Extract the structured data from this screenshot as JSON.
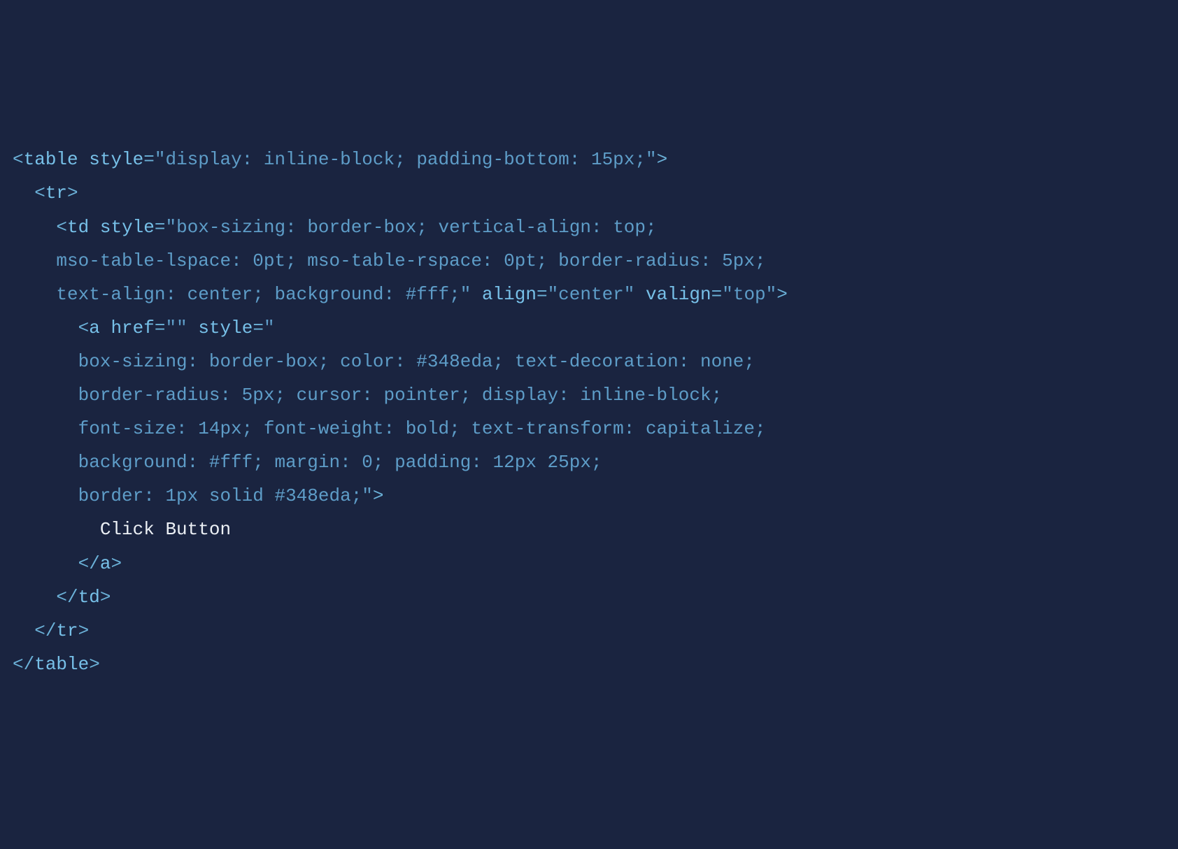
{
  "code": {
    "l1": {
      "p1": "<",
      "tag": "table",
      "sp1": " ",
      "attr1": "style",
      "eq": "=",
      "str1": "\"display: inline-block; padding-bottom: 15px;\"",
      "p2": ">"
    },
    "l2": {
      "indent": "  ",
      "p1": "<",
      "tag": "tr",
      "p2": ">"
    },
    "l3": {
      "indent": "    ",
      "p1": "<",
      "tag": "td",
      "sp1": " ",
      "attr1": "style",
      "eq": "=",
      "str1": "\"box-sizing: border-box; vertical-align: top;"
    },
    "l4": {
      "indent": "    ",
      "str1": "mso-table-lspace: 0pt; mso-table-rspace: 0pt; border-radius: 5px;"
    },
    "l5": {
      "indent": "    ",
      "str1": "text-align: center; background: #fff;\"",
      "sp1": " ",
      "attr1": "align",
      "eq1": "=",
      "str2": "\"center\"",
      "sp2": " ",
      "attr2": "valign",
      "eq2": "=",
      "str3": "\"top\"",
      "p1": ">"
    },
    "l6": {
      "indent": "      ",
      "p1": "<",
      "tag": "a",
      "sp1": " ",
      "attr1": "href",
      "eq1": "=",
      "str1": "\"\"",
      "sp2": " ",
      "attr2": "style",
      "eq2": "=",
      "str2": "\""
    },
    "l7": {
      "indent": "      ",
      "str1": "box-sizing: border-box; color: #348eda; text-decoration: none;"
    },
    "l8": {
      "indent": "      ",
      "str1": "border-radius: 5px; cursor: pointer; display: inline-block;"
    },
    "l9": {
      "indent": "      ",
      "str1": "font-size: 14px; font-weight: bold; text-transform: capitalize;"
    },
    "l10": {
      "indent": "      ",
      "str1": "background: #fff; margin: 0; padding: 12px 25px;"
    },
    "l11": {
      "indent": "      ",
      "str1": "border: 1px solid #348eda;\"",
      "p1": ">"
    },
    "l12": {
      "indent": "        ",
      "txt": "Click Button"
    },
    "l13": {
      "indent": "      ",
      "p1": "</",
      "tag": "a",
      "p2": ">"
    },
    "l14": {
      "indent": "    ",
      "p1": "</",
      "tag": "td",
      "p2": ">"
    },
    "l15": {
      "indent": "  ",
      "p1": "</",
      "tag": "tr",
      "p2": ">"
    },
    "l16": {
      "p1": "</",
      "tag": "table",
      "p2": ">"
    }
  }
}
